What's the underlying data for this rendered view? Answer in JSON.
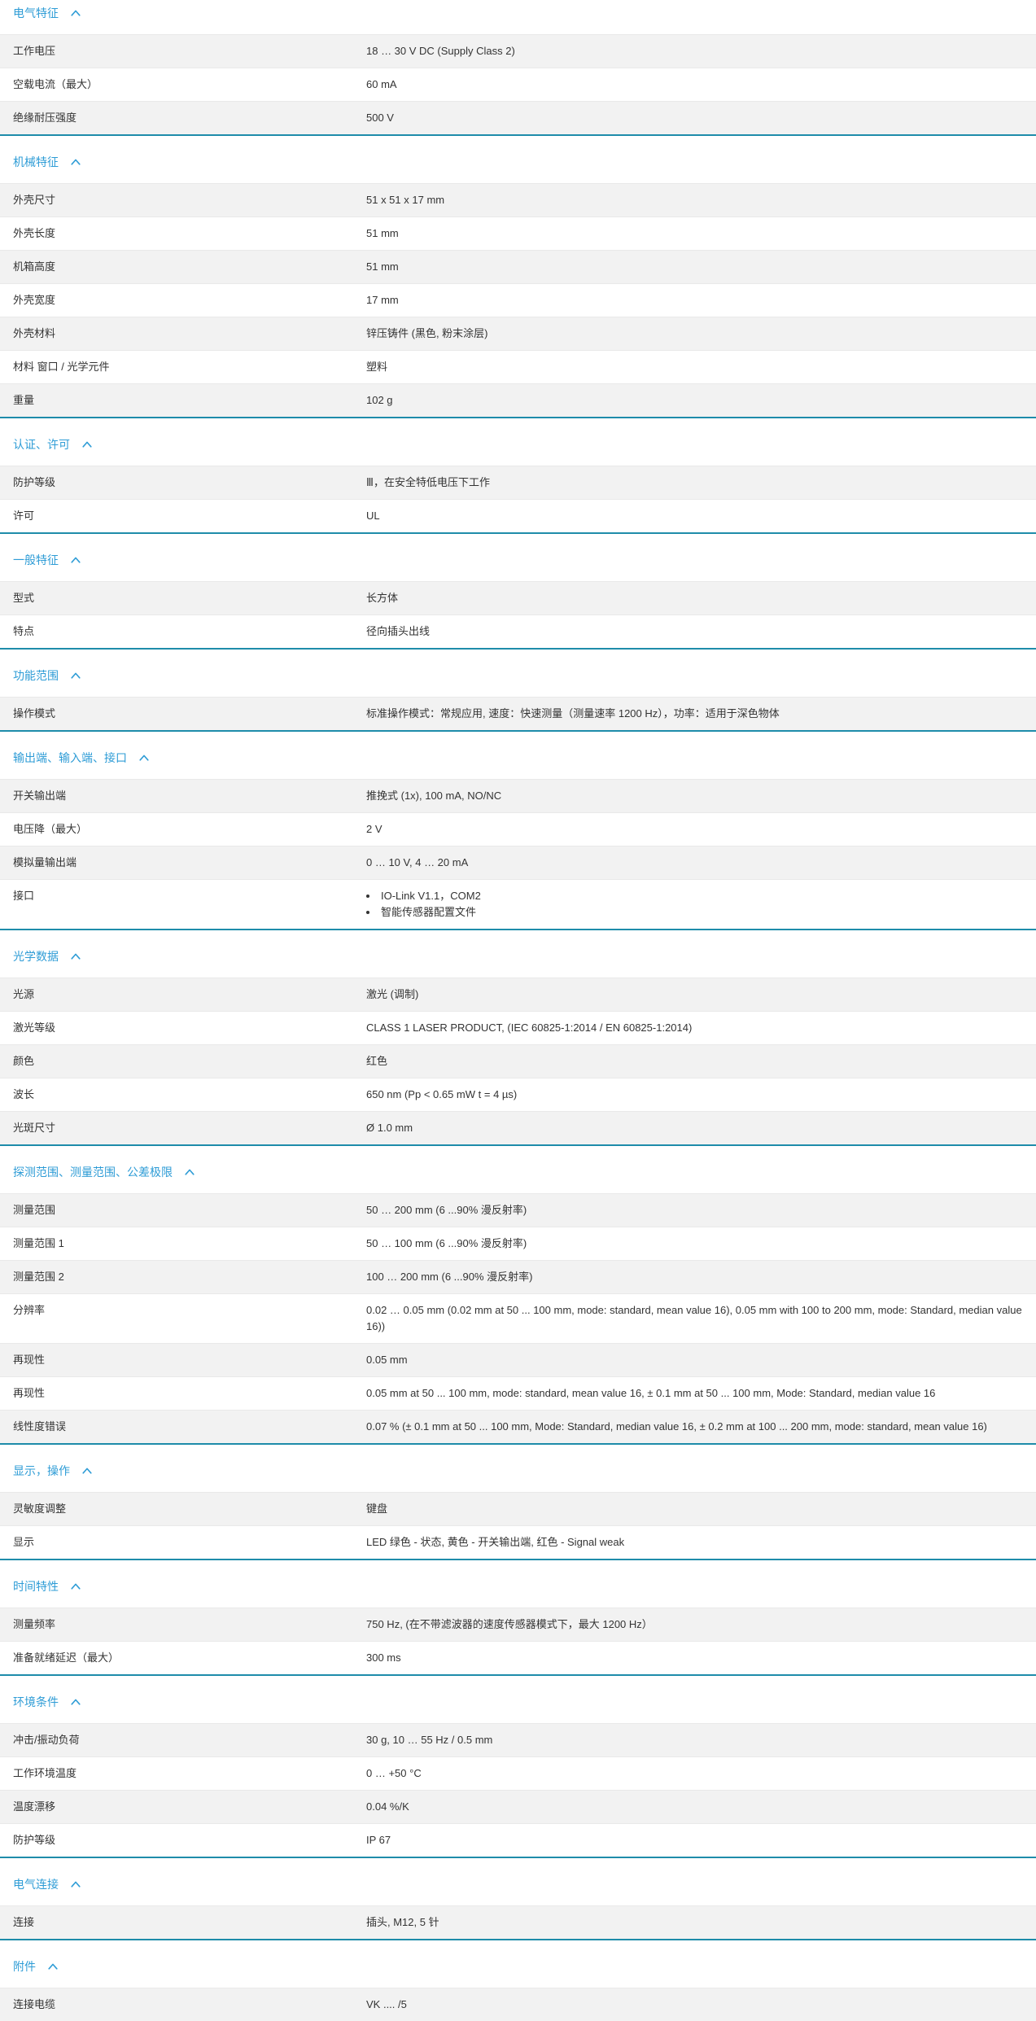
{
  "colors": {
    "section_title": "#2e9cd6",
    "section_divider": "#1e8caa",
    "row_alt_background": "#f2f2f2",
    "text": "#333333"
  },
  "sections": [
    {
      "title": "电气特征",
      "icon": "chevron-up-icon",
      "rows": [
        {
          "label": "工作电压",
          "value": "18 … 30 V DC (Supply Class 2)"
        },
        {
          "label": "空载电流（最大）",
          "value": "60 mA"
        },
        {
          "label": "绝缘耐压强度",
          "value": "500 V"
        }
      ]
    },
    {
      "title": "机械特征",
      "icon": "chevron-up-icon",
      "rows": [
        {
          "label": "外壳尺寸",
          "value": "51 x 51 x 17 mm"
        },
        {
          "label": "外壳长度",
          "value": "51 mm"
        },
        {
          "label": "机箱高度",
          "value": "51 mm"
        },
        {
          "label": "外壳宽度",
          "value": "17 mm"
        },
        {
          "label": "外壳材料",
          "value": "锌压铸件 (黑色, 粉末涂层)"
        },
        {
          "label": "材料 窗口 / 光学元件",
          "value": "塑料"
        },
        {
          "label": "重量",
          "value": "102 g"
        }
      ]
    },
    {
      "title": "认证、许可",
      "icon": "chevron-up-icon",
      "rows": [
        {
          "label": "防护等级",
          "value": "Ⅲ，在安全特低电压下工作"
        },
        {
          "label": "许可",
          "value": "UL"
        }
      ]
    },
    {
      "title": "一般特征",
      "icon": "chevron-up-icon",
      "rows": [
        {
          "label": "型式",
          "value": "长方体"
        },
        {
          "label": "特点",
          "value": "径向插头出线"
        }
      ]
    },
    {
      "title": "功能范围",
      "icon": "chevron-up-icon",
      "rows": [
        {
          "label": "操作模式",
          "value": "标准操作模式：常规应用, 速度：快速测量（测量速率 1200 Hz），功率：适用于深色物体"
        }
      ]
    },
    {
      "title": "输出端、输入端、接口",
      "icon": "chevron-up-icon",
      "rows": [
        {
          "label": "开关输出端",
          "value": "推挽式 (1x), 100 mA, NO/NC"
        },
        {
          "label": "电压降（最大）",
          "value": "2 V"
        },
        {
          "label": "模拟量输出端",
          "value": "0 … 10 V, 4 … 20 mA"
        },
        {
          "label": "接口",
          "bullets": [
            "IO-Link V1.1，COM2",
            "智能传感器配置文件"
          ]
        }
      ]
    },
    {
      "title": "光学数据",
      "icon": "chevron-up-icon",
      "rows": [
        {
          "label": "光源",
          "value": "激光 (调制)"
        },
        {
          "label": "激光等级",
          "value": "CLASS 1 LASER PRODUCT, (IEC 60825-1:2014 / EN 60825-1:2014)"
        },
        {
          "label": "颜色",
          "value": "红色"
        },
        {
          "label": "波长",
          "value": "650 nm (Pp < 0.65 mW t = 4 µs)"
        },
        {
          "label": "光斑尺寸",
          "value": "Ø 1.0 mm"
        }
      ]
    },
    {
      "title": "探测范围、测量范围、公差极限",
      "icon": "chevron-up-icon",
      "rows": [
        {
          "label": "测量范围",
          "value": "50 … 200 mm (6 ...90% 漫反射率)"
        },
        {
          "label": "测量范围 1",
          "value": "50 … 100 mm (6 ...90% 漫反射率)"
        },
        {
          "label": "测量范围 2",
          "value": "100 … 200 mm (6 ...90% 漫反射率)"
        },
        {
          "label": "分辨率",
          "value": "0.02 … 0.05 mm (0.02 mm at 50 ... 100 mm, mode: standard, mean value 16), 0.05 mm with 100 to 200 mm, mode: Standard, median value 16))"
        },
        {
          "label": "再现性",
          "value": "0.05 mm"
        },
        {
          "label": "再现性",
          "value": "0.05 mm at 50 ... 100 mm, mode: standard, mean value 16, ± 0.1 mm at 50 ... 100 mm, Mode: Standard, median value 16"
        },
        {
          "label": "线性度错误",
          "value": "0.07 % (± 0.1 mm at 50 ... 100 mm, Mode: Standard, median value 16, ± 0.2 mm at 100 ... 200 mm, mode: standard, mean value 16)"
        }
      ]
    },
    {
      "title": "显示，操作",
      "icon": "chevron-up-icon",
      "rows": [
        {
          "label": "灵敏度调整",
          "value": "键盘"
        },
        {
          "label": "显示",
          "value": "LED 绿色 - 状态, 黄色 - 开关输出端, 红色 - Signal weak"
        }
      ]
    },
    {
      "title": "时间特性",
      "icon": "chevron-up-icon",
      "rows": [
        {
          "label": "测量频率",
          "value": "750 Hz, (在不带滤波器的速度传感器模式下，最大 1200 Hz）"
        },
        {
          "label": "准备就绪延迟（最大）",
          "value": "300 ms"
        }
      ]
    },
    {
      "title": "环境条件",
      "icon": "chevron-up-icon",
      "rows": [
        {
          "label": "冲击/振动负荷",
          "value": "30 g, 10 … 55 Hz / 0.5 mm"
        },
        {
          "label": "工作环境温度",
          "value": "0 … +50 °C"
        },
        {
          "label": "温度漂移",
          "value": "0.04 %/K"
        },
        {
          "label": "防护等级",
          "value": "IP 67"
        }
      ]
    },
    {
      "title": "电气连接",
      "icon": "chevron-up-icon",
      "rows": [
        {
          "label": "连接",
          "value": "插头, M12, 5 针"
        }
      ]
    },
    {
      "title": "附件",
      "icon": "chevron-up-icon",
      "rows": [
        {
          "label": "连接电缆",
          "value": "VK .... /5"
        }
      ]
    }
  ]
}
